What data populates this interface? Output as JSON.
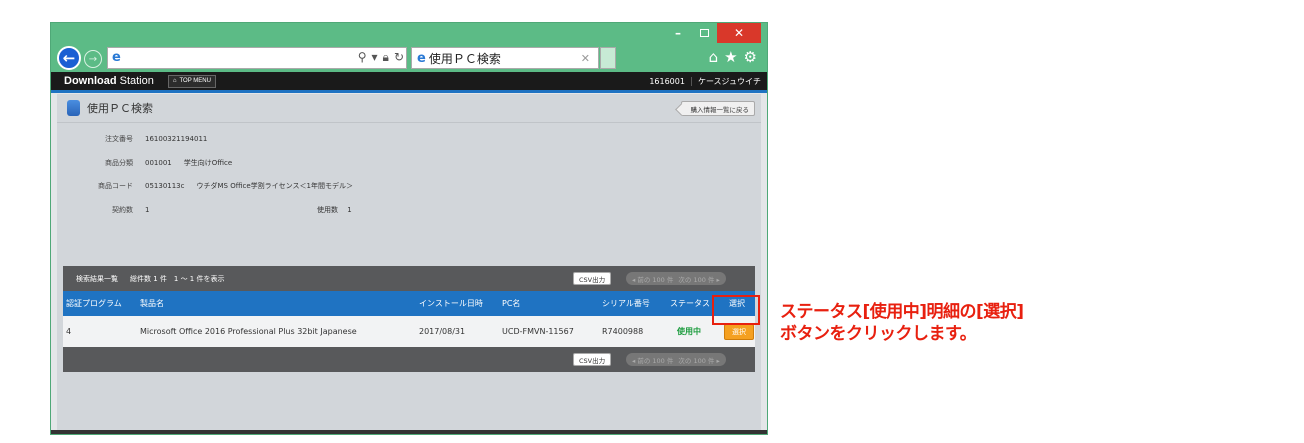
{
  "browser": {
    "tab_title": "使用ＰＣ検索",
    "window_controls": {
      "minimize": "–",
      "maximize": "",
      "close": "✕"
    },
    "icons": [
      "back-arrow-icon",
      "forward-arrow-icon",
      "ie-logo-icon",
      "search-icon",
      "lock-icon",
      "refresh-icon",
      "home-icon",
      "star-icon",
      "gear-icon"
    ]
  },
  "app": {
    "brand_bold": "Download",
    "brand_light": " Station",
    "top_menu": "TOP MENU",
    "account_id": "1616001",
    "user_name": "ケースジュウイチ"
  },
  "page": {
    "title": "使用ＰＣ検索",
    "back_button": "購入情報一覧に戻る"
  },
  "order": {
    "order_no_label": "注文番号",
    "order_no": "16100321194011",
    "category_label": "商品分類",
    "category_code": "001001",
    "category_name": "学生向けOffice",
    "product_code_label": "商品コード",
    "product_code": "05130113c",
    "product_name": "ウチダMS Office学割ライセンス＜1年間モデル＞",
    "contracts_label": "契約数",
    "contracts": "1",
    "used_label": "使用数",
    "used": "1"
  },
  "results": {
    "caption": "検索結果一覧",
    "count_text": "総件数 1 件　1 ～ 1 件を表示",
    "csv": "CSV出力",
    "prev": "前の 100 件",
    "next": "次の 100 件",
    "columns": [
      "認証プログラム",
      "製品名",
      "インストール日時",
      "PC名",
      "シリアル番号",
      "ステータス",
      "選択"
    ],
    "rows": [
      {
        "program": "4",
        "product": "Microsoft Office 2016 Professional Plus 32bit Japanese",
        "install_date": "2017/08/31",
        "pc_name": "UCD-FMVN-11567",
        "serial": "R7400988",
        "status": "使用中",
        "select": "選択"
      }
    ]
  },
  "annotation": {
    "line1": "ステータス[使用中]明細の[選択]",
    "line2": "ボタンをクリックします。",
    "color": "#e8200f"
  }
}
